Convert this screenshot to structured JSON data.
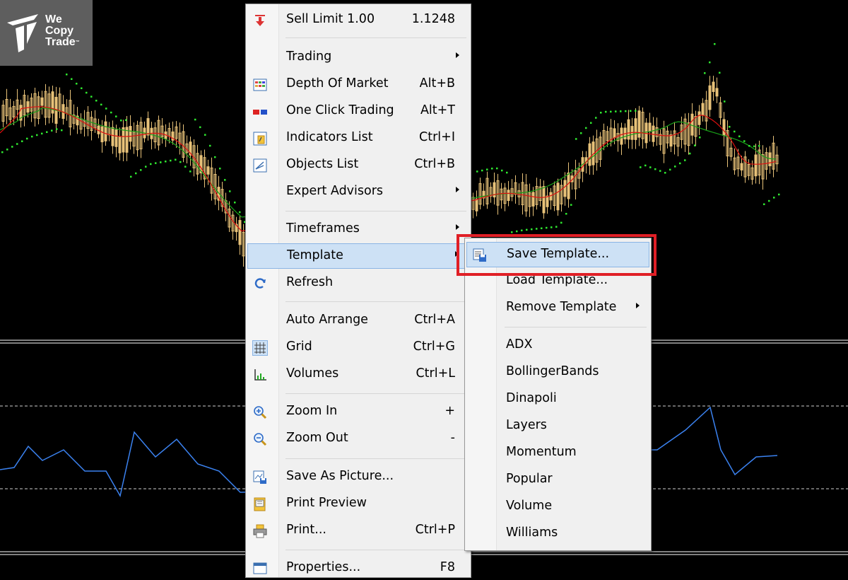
{
  "brand": {
    "line1": "We",
    "line2": "Copy",
    "line3": "Trade",
    "tm": "™"
  },
  "colors": {
    "background": "#000000",
    "candle": "#e8c279",
    "sar": "#2fe830",
    "ma_fast": "#e01010",
    "ma_slow": "#18a018",
    "indicator_line": "#3b82f0",
    "highlight": "#cde1f5",
    "callout": "#e01f26"
  },
  "context_menu": {
    "items": [
      {
        "label": "Sell Limit 1.00",
        "shortcut": "1.1248",
        "icon": "sell-arrow-icon"
      },
      {
        "label": "Trading",
        "submenu": true
      },
      {
        "label": "Depth Of Market",
        "shortcut": "Alt+B",
        "icon": "depth-of-market-icon"
      },
      {
        "label": "One Click Trading",
        "shortcut": "Alt+T",
        "icon": "one-click-trading-icon"
      },
      {
        "label": "Indicators List",
        "shortcut": "Ctrl+I",
        "icon": "indicators-list-icon"
      },
      {
        "label": "Objects List",
        "shortcut": "Ctrl+B",
        "icon": "objects-list-icon"
      },
      {
        "label": "Expert Advisors",
        "submenu": true
      },
      {
        "label": "Timeframes",
        "submenu": true
      },
      {
        "label": "Template",
        "submenu": true,
        "highlighted": true
      },
      {
        "label": "Refresh",
        "icon": "refresh-icon"
      },
      {
        "label": "Auto Arrange",
        "shortcut": "Ctrl+A"
      },
      {
        "label": "Grid",
        "shortcut": "Ctrl+G",
        "icon": "grid-icon"
      },
      {
        "label": "Volumes",
        "shortcut": "Ctrl+L",
        "icon": "volumes-icon"
      },
      {
        "label": "Zoom In",
        "shortcut": "+",
        "icon": "zoom-in-icon"
      },
      {
        "label": "Zoom Out",
        "shortcut": "-",
        "icon": "zoom-out-icon"
      },
      {
        "label": "Save As Picture...",
        "icon": "save-picture-icon"
      },
      {
        "label": "Print Preview",
        "icon": "print-preview-icon"
      },
      {
        "label": "Print...",
        "shortcut": "Ctrl+P",
        "icon": "printer-icon"
      },
      {
        "label": "Properties...",
        "shortcut": "F8",
        "icon": "properties-icon"
      }
    ]
  },
  "template_submenu": {
    "items": [
      {
        "label": "Save Template...",
        "highlighted": true,
        "icon": "save-template-icon"
      },
      {
        "label": "Load Template..."
      },
      {
        "label": "Remove Template",
        "submenu": true
      },
      {
        "label": "ADX"
      },
      {
        "label": "BollingerBands"
      },
      {
        "label": "Dinapoli"
      },
      {
        "label": "Layers"
      },
      {
        "label": "Momentum"
      },
      {
        "label": "Popular"
      },
      {
        "label": "Volume"
      },
      {
        "label": "Williams"
      }
    ]
  }
}
